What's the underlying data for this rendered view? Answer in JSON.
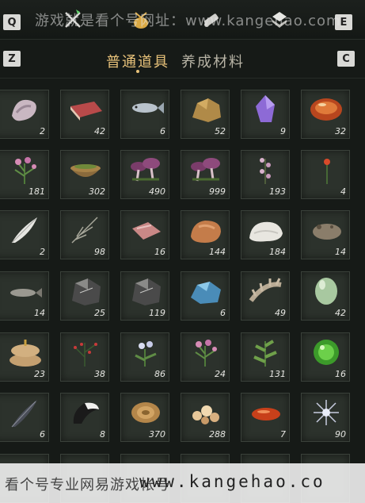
{
  "hotkeys": {
    "left_top": "Q",
    "right_top": "E",
    "tab_prev": "Z",
    "tab_next": "C"
  },
  "top_icons": [
    "crossed-swords-icon",
    "money-pouch-icon",
    "scroll-icon",
    "gem-shield-icon"
  ],
  "watermark_top": "游戏就是看个号网址：www.kangehao.com",
  "tabs": [
    {
      "label": "普通道具",
      "active": true
    },
    {
      "label": "养成材料",
      "active": false
    }
  ],
  "items": [
    {
      "icon": "cloth-bundle-icon",
      "count": "2"
    },
    {
      "icon": "raw-meat-icon",
      "count": "42"
    },
    {
      "icon": "fish-icon",
      "count": "6"
    },
    {
      "icon": "ore-lump-icon",
      "count": "52"
    },
    {
      "icon": "purple-crystal-icon",
      "count": "9"
    },
    {
      "icon": "red-agate-icon",
      "count": "32"
    },
    {
      "icon": "pink-flower-herb-icon",
      "count": "181"
    },
    {
      "icon": "herb-bowl-icon",
      "count": "302"
    },
    {
      "icon": "purple-mushroom-icon",
      "count": "490"
    },
    {
      "icon": "purple-mushroom-icon",
      "count": "999"
    },
    {
      "icon": "pink-blossom-icon",
      "count": "193"
    },
    {
      "icon": "red-flower-icon",
      "count": "4"
    },
    {
      "icon": "white-feather-icon",
      "count": "2"
    },
    {
      "icon": "grass-stalk-icon",
      "count": "98"
    },
    {
      "icon": "meat-slice-icon",
      "count": "16"
    },
    {
      "icon": "rock-ore-icon",
      "count": "144"
    },
    {
      "icon": "wool-fur-icon",
      "count": "184"
    },
    {
      "icon": "toad-icon",
      "count": "14"
    },
    {
      "icon": "small-fish-icon",
      "count": "14"
    },
    {
      "icon": "dark-ore-icon",
      "count": "25"
    },
    {
      "icon": "dark-ore-icon",
      "count": "119"
    },
    {
      "icon": "blue-ore-icon",
      "count": "6"
    },
    {
      "icon": "bone-spine-icon",
      "count": "49"
    },
    {
      "icon": "green-egg-icon",
      "count": "42"
    },
    {
      "icon": "sack-icon",
      "count": "23"
    },
    {
      "icon": "red-berry-bush-icon",
      "count": "38"
    },
    {
      "icon": "white-flower-herb-icon",
      "count": "86"
    },
    {
      "icon": "pink-flower-herb-icon",
      "count": "24"
    },
    {
      "icon": "green-herb-icon",
      "count": "131"
    },
    {
      "icon": "green-orb-icon",
      "count": "16"
    },
    {
      "icon": "dark-feather-icon",
      "count": "6"
    },
    {
      "icon": "black-white-tail-icon",
      "count": "8"
    },
    {
      "icon": "wood-slice-icon",
      "count": "370"
    },
    {
      "icon": "pebbles-icon",
      "count": "288"
    },
    {
      "icon": "red-bean-icon",
      "count": "7"
    },
    {
      "icon": "silver-sparkle-icon",
      "count": "90"
    }
  ],
  "watermark_bottom": {
    "text": "看个号专业网易游戏帐号",
    "url": "www.kangehao.co"
  }
}
